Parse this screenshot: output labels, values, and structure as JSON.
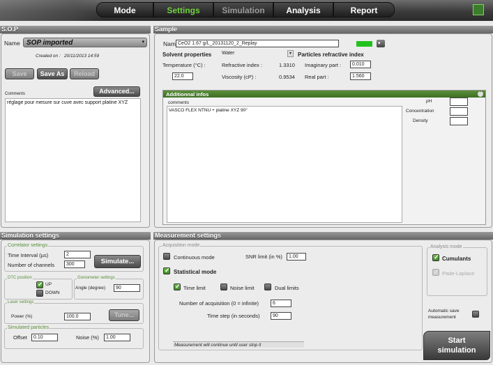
{
  "nav": {
    "tabs": [
      "Mode",
      "Settings",
      "Simulation",
      "Analysis",
      "Report"
    ],
    "active": "Settings"
  },
  "sop": {
    "title": "S.O.P",
    "name_label": "Name",
    "name_value": "SOP imported",
    "created_label": "Created on :",
    "created_value": "20/11/2013 14:59",
    "save": "Save",
    "save_as": "Save As",
    "reload": "Reload",
    "comments_label": "Comments",
    "advanced": "Advanced...",
    "comment_text": "réglage pour mesure sur cuve avec support platine XYZ"
  },
  "sample": {
    "title": "Sample",
    "name_label": "Name",
    "name_value": "CeO2 1.67 g/L_20131120_2_Replay",
    "color": "#22c21e",
    "solvent_label": "Solvent properties",
    "solvent_value": "Water",
    "particles_label": "Particles refractive index",
    "temp_label": "Temperature (°C) :",
    "temp_value": "22.0",
    "refr_label": "Refractive index :",
    "refr_value": "1.3310",
    "visc_label": "Viscosity (cP) :",
    "visc_value": "0.9534",
    "imag_label": "Imaginary part :",
    "imag_value": "0.010",
    "real_label": "Real part :",
    "real_value": "1.560",
    "addl_title": "Additionnal infos",
    "addl_comments_label": "comments",
    "addl_comments_text": "VASCO FLEX NTNU + platine XYZ 90°",
    "ph_label": "pH",
    "conc_label": "Concentration",
    "density_label": "Density"
  },
  "simset": {
    "title": "Simulation settings",
    "correlator_label": "Correlator settings",
    "time_label": "Time Interval (µs)",
    "time_value": "2",
    "channels_label": "Number of channels",
    "channels_value": "300",
    "simulate": "Simulate...",
    "dtc_label": "DTC position",
    "up": "UP",
    "down": "DOWN",
    "gonio_label": "Goniometer settings",
    "angle_label": "Angle (degree)",
    "angle_value": "90",
    "laser_label": "Laser settings",
    "power_label": "Power (%)",
    "power_value": "100.0",
    "tune": "Tune...",
    "particles_label": "Simulated particles",
    "offset_label": "Offset",
    "offset_value": "0.10",
    "noise_label": "Noise (%)",
    "noise_value": "1.00"
  },
  "meas": {
    "title": "Measurement settings",
    "acq_label": "Acquisition mode",
    "continuous": "Continuous mode",
    "snr_label": "SNR limit (in %)",
    "snr_value": "1.00",
    "statistical": "Statistical mode",
    "time_limit": "Time limit",
    "noise_limit": "Noise limit",
    "dual_limits": "Dual limits",
    "nacq_label": "Number of acquisition (0 = infinite)",
    "nacq_value": "6",
    "timestep_label": "Time step (in seconds)",
    "timestep_value": "90",
    "status": "Measurement will continue until user stop it",
    "analysis_label": "Analysis mode",
    "cumulants": "Cumulants",
    "pade": "Pade-Laplace",
    "autosave": "Automatic save measurement",
    "start_line1": "Start",
    "start_line2": "simulation"
  }
}
